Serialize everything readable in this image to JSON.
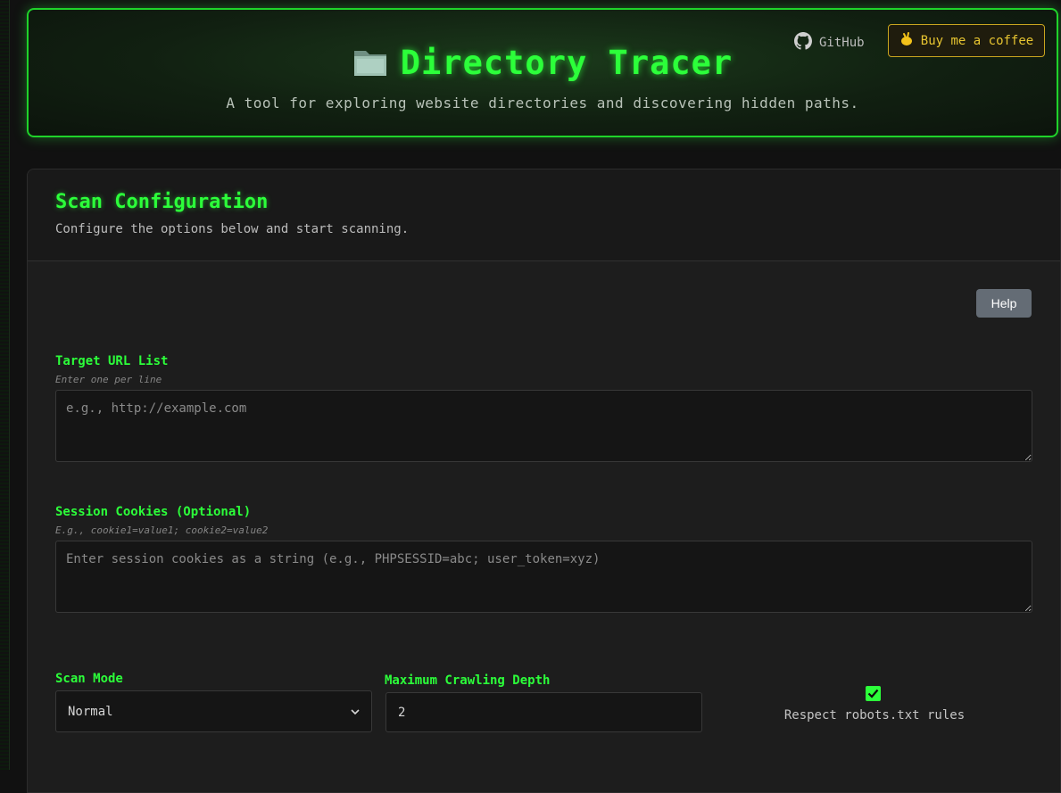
{
  "header": {
    "title": "Directory Tracer",
    "subtitle": "A tool for exploring website directories and discovering hidden paths.",
    "github_label": "GitHub",
    "coffee_label": "Buy me a coffee",
    "accent": "#2cff3a"
  },
  "config": {
    "title": "Scan Configuration",
    "subtitle": "Configure the options below and start scanning.",
    "help_label": "Help"
  },
  "target_urls": {
    "label": "Target URL List",
    "hint": "Enter one per line",
    "placeholder": "e.g., http://example.com",
    "value": ""
  },
  "cookies": {
    "label": "Session Cookies (Optional)",
    "hint": "E.g., cookie1=value1; cookie2=value2",
    "placeholder": "Enter session cookies as a string (e.g., PHPSESSID=abc; user_token=xyz)",
    "value": ""
  },
  "scan_mode": {
    "label": "Scan Mode",
    "selected": "Normal"
  },
  "depth": {
    "label": "Maximum Crawling Depth",
    "value": "2"
  },
  "robots": {
    "label": "Respect robots.txt rules",
    "checked": true
  }
}
